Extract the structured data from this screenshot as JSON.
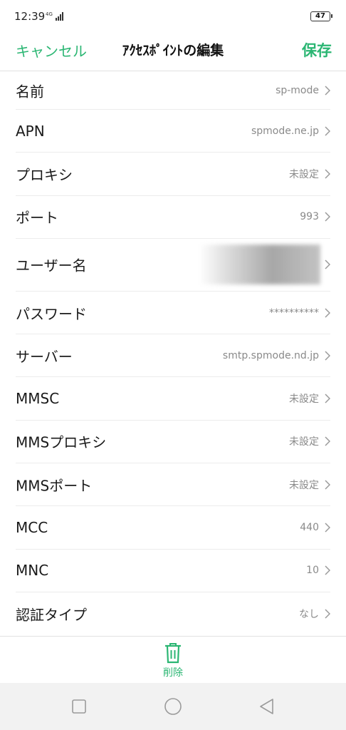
{
  "status": {
    "time": "12:39",
    "network": "4G",
    "battery": "47"
  },
  "header": {
    "cancel_label": "キャンセル",
    "title": "ｱｸｾｽﾎﾟｲﾝﾄの編集",
    "save_label": "保存"
  },
  "rows": [
    {
      "label": "名前",
      "value": "sp-mode"
    },
    {
      "label": "APN",
      "value": "spmode.ne.jp"
    },
    {
      "label": "プロキシ",
      "value": "未設定"
    },
    {
      "label": "ポート",
      "value": "993"
    },
    {
      "label": "ユーザー名",
      "value": ""
    },
    {
      "label": "パスワード",
      "value": "**********"
    },
    {
      "label": "サーバー",
      "value": "smtp.spmode.nd.jp"
    },
    {
      "label": "MMSC",
      "value": "未設定"
    },
    {
      "label": "MMSプロキシ",
      "value": "未設定"
    },
    {
      "label": "MMSポート",
      "value": "未設定"
    },
    {
      "label": "MCC",
      "value": "440"
    },
    {
      "label": "MNC",
      "value": "10"
    },
    {
      "label": "認証タイプ",
      "value": "なし"
    }
  ],
  "toolbar": {
    "delete_label": "削除"
  },
  "colors": {
    "accent": "#2bb673",
    "label": "#1a1a1a",
    "value": "#8a8a8a"
  },
  "icons": {
    "signal": "signal-bars-icon",
    "battery": "battery-icon",
    "chevron": "chevron-right-icon",
    "trash": "trash-icon",
    "recent": "square-icon",
    "home": "circle-icon",
    "back": "triangle-back-icon"
  }
}
